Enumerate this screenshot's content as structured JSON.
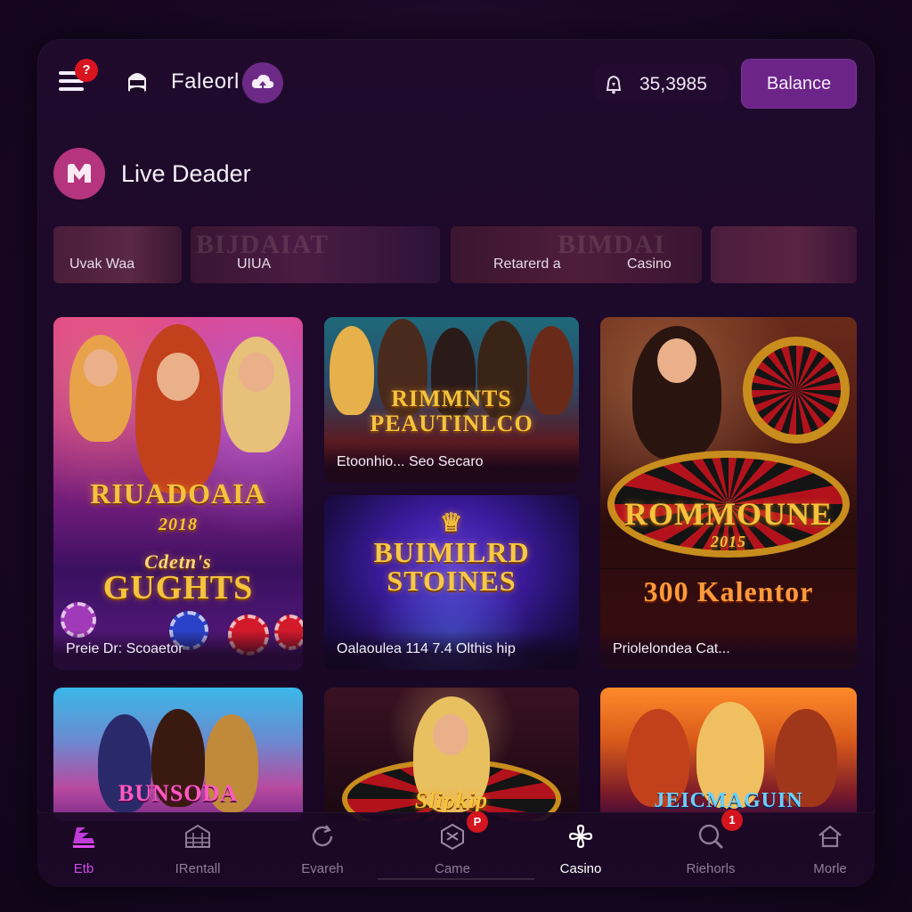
{
  "header": {
    "menu_badge": "?",
    "brand_name": "Faleorl",
    "balance_amount": "35,3985",
    "balance_button": "Balance"
  },
  "section": {
    "title": "Live Deader"
  },
  "categories": [
    {
      "label": "Uvak Waa",
      "ghost": ""
    },
    {
      "label": "UIUA",
      "ghost": "BIJDAIAT"
    },
    {
      "label": "Retarerd a",
      "ghost": ""
    },
    {
      "label": "Casino",
      "ghost": "BIMDAI"
    }
  ],
  "games": [
    {
      "title_art": "RIUADOAIA",
      "year": "2018",
      "subtitle_art": "GUGHTS",
      "script_art": "Cdetn's",
      "caption": "Preie Dr: Scoaetor"
    },
    {
      "title_art": "RIMMNTS PEAUTINLCO",
      "caption": "Etoonhio... Seo Secaro"
    },
    {
      "title_art": "BUIMILRD STOINES",
      "caption": "Oalaoulea 114 7.4 Olthis hip"
    },
    {
      "title_art": "ROMMOUNE",
      "year": "2015",
      "caption": "Priolelondea Cat...",
      "promo_art": "300 Kalentor"
    },
    {
      "title_art": "BUNSODA",
      "caption": ""
    },
    {
      "title_art": "Slipkip",
      "caption": ""
    },
    {
      "title_art": "JEICMAGUIN",
      "caption": ""
    }
  ],
  "bottom_nav": [
    {
      "label": "Etb",
      "icon": "slots-icon",
      "active_color": true
    },
    {
      "label": "IRentall",
      "icon": "building-icon"
    },
    {
      "label": "Evareh",
      "icon": "refresh-icon"
    },
    {
      "label": "Came",
      "icon": "hexagon-icon",
      "badge": "P"
    },
    {
      "label": "Casino",
      "icon": "clover-icon",
      "active": true
    },
    {
      "label": "Riehorls",
      "icon": "search-icon",
      "badge": "1"
    },
    {
      "label": "Morle",
      "icon": "home-icon"
    }
  ],
  "colors": {
    "background": "#1a0826",
    "accent": "#6c2488",
    "badge": "#d4141e",
    "gold": "#f5c33d"
  }
}
